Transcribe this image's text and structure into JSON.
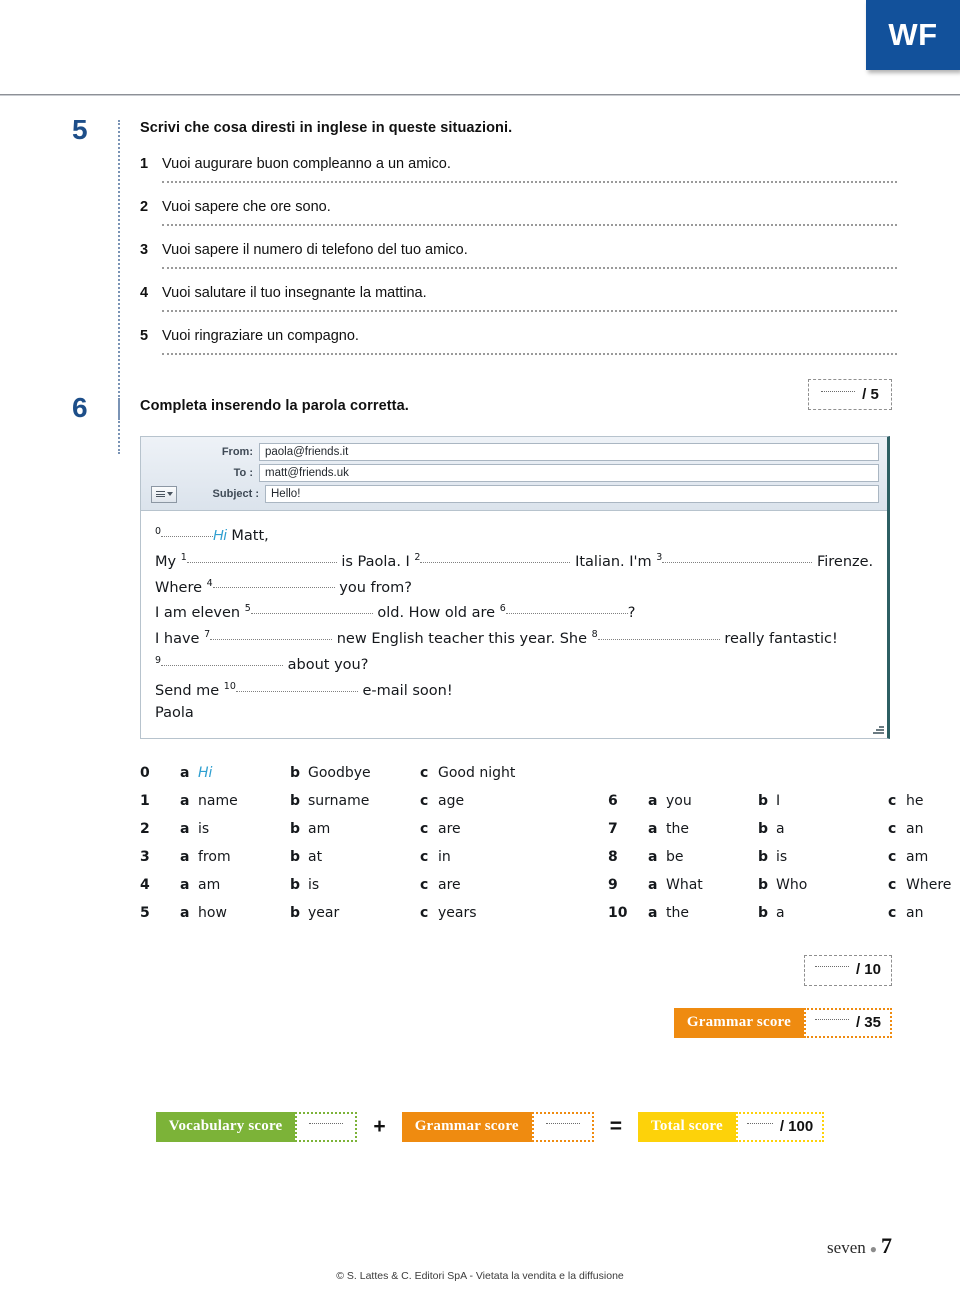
{
  "header": {
    "logo": "WF"
  },
  "exercise5": {
    "number": "5",
    "title": "Scrivi che cosa diresti in inglese in queste situazioni.",
    "questions": [
      {
        "no": "1",
        "text": "Vuoi augurare buon compleanno a un amico."
      },
      {
        "no": "2",
        "text": "Vuoi sapere che ore sono."
      },
      {
        "no": "3",
        "text": "Vuoi sapere il numero di telefono del tuo amico."
      },
      {
        "no": "4",
        "text": "Vuoi salutare il tuo insegnante la mattina."
      },
      {
        "no": "5",
        "text": "Vuoi ringraziare un compagno."
      }
    ],
    "score": "/ 5"
  },
  "exercise6": {
    "number": "6",
    "title": "Completa inserendo la parola corretta.",
    "score": "/ 10",
    "email": {
      "from_label": "From:",
      "from_value": "paola@friends.it",
      "to_label": "To :",
      "to_value": "matt@friends.uk",
      "subject_label": "Subject :",
      "subject_value": "Hello!",
      "body": {
        "n0": "0",
        "answer0": "Hi",
        "greeting_name": "Matt,",
        "l2_a": "My",
        "n1": "1",
        "l2_b": "is Paola. I",
        "n2": "2",
        "l2_c": "Italian. I'm",
        "n3": "3",
        "l2_d": "Firenze.",
        "l3_a": "Where",
        "n4": "4",
        "l3_b": "you from?",
        "l4_a": "I am eleven",
        "n5": "5",
        "l4_b": "old. How old are",
        "n6": "6",
        "l4_c": "?",
        "l5_a": "I have",
        "n7": "7",
        "l5_b": "new English teacher this year. She",
        "n8": "8",
        "l5_c": "really fantastic!",
        "n9": "9",
        "l6_b": "about you?",
        "l7_a": "Send me",
        "n10": "10",
        "l7_b": "e-mail soon!",
        "signature": "Paola"
      }
    },
    "options_left": [
      {
        "idx": "0",
        "a": "Hi",
        "b": "Goodbye",
        "c": "Good night",
        "a_is_answer": true
      },
      {
        "idx": "1",
        "a": "name",
        "b": "surname",
        "c": "age",
        "a_is_answer": false
      },
      {
        "idx": "2",
        "a": "is",
        "b": "am",
        "c": "are",
        "a_is_answer": false
      },
      {
        "idx": "3",
        "a": "from",
        "b": "at",
        "c": "in",
        "a_is_answer": false
      },
      {
        "idx": "4",
        "a": "am",
        "b": "is",
        "c": "are",
        "a_is_answer": false
      },
      {
        "idx": "5",
        "a": "how",
        "b": "year",
        "c": "years",
        "a_is_answer": false
      }
    ],
    "options_right": [
      {
        "idx": "6",
        "a": "you",
        "b": "I",
        "c": "he"
      },
      {
        "idx": "7",
        "a": "the",
        "b": "a",
        "c": "an"
      },
      {
        "idx": "8",
        "a": "be",
        "b": "is",
        "c": "am"
      },
      {
        "idx": "9",
        "a": "What",
        "b": "Who",
        "c": "Where"
      },
      {
        "idx": "10",
        "a": "the",
        "b": "a",
        "c": "an"
      }
    ],
    "letters": {
      "a": "a",
      "b": "b",
      "c": "c"
    }
  },
  "grammar_strip": {
    "label": "Grammar score",
    "value": "/ 35"
  },
  "totals": {
    "vocabulary_label": "Vocabulary score",
    "vocabulary_value": "",
    "plus": "+",
    "grammar_label": "Grammar score",
    "grammar_value": "",
    "equals": "=",
    "total_label": "Total score",
    "total_value": "/ 100"
  },
  "footer": {
    "folio_word": "seven",
    "folio_dot": "●",
    "folio_number": "7",
    "copyright": "© S. Lattes & C. Editori SpA - Vietata la vendita e la diffusione"
  },
  "colors": {
    "brand_blue": "#12519b",
    "number_blue": "#1d4e89",
    "answer_blue": "#2f9fd0",
    "green": "#7cb338",
    "orange": "#ef8b10",
    "yellow": "#fdd20a"
  }
}
